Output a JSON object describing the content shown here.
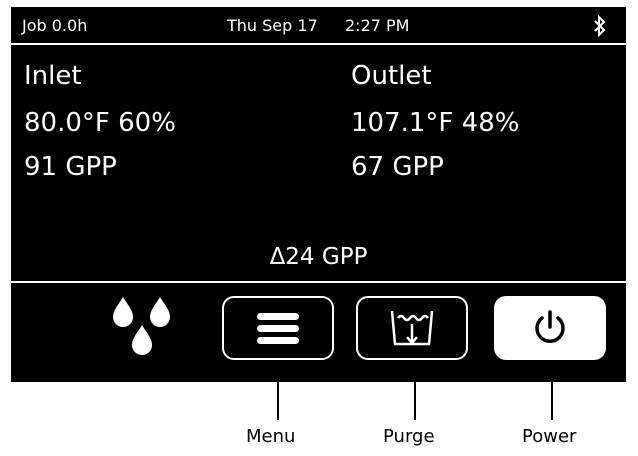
{
  "status": {
    "job": "Job 0.0h",
    "date": "Thu Sep 17",
    "time": "2:27 PM",
    "bluetooth_icon": "bluetooth-icon"
  },
  "inlet": {
    "label": "Inlet",
    "temp_humidity": "80.0°F 60%",
    "gpp": "91 GPP"
  },
  "outlet": {
    "label": "Outlet",
    "temp_humidity": "107.1°F 48%",
    "gpp": "67 GPP"
  },
  "delta": "Δ24 GPP",
  "controls": {
    "water_icon": "water-drops-icon",
    "menu_icon": "menu-icon",
    "purge_icon": "purge-icon",
    "power_icon": "power-icon"
  },
  "callouts": {
    "menu": "Menu",
    "purge": "Purge",
    "power": "Power"
  },
  "colors": {
    "screen": "#000000",
    "text": "#ffffff",
    "power_button": "#ffffff"
  }
}
